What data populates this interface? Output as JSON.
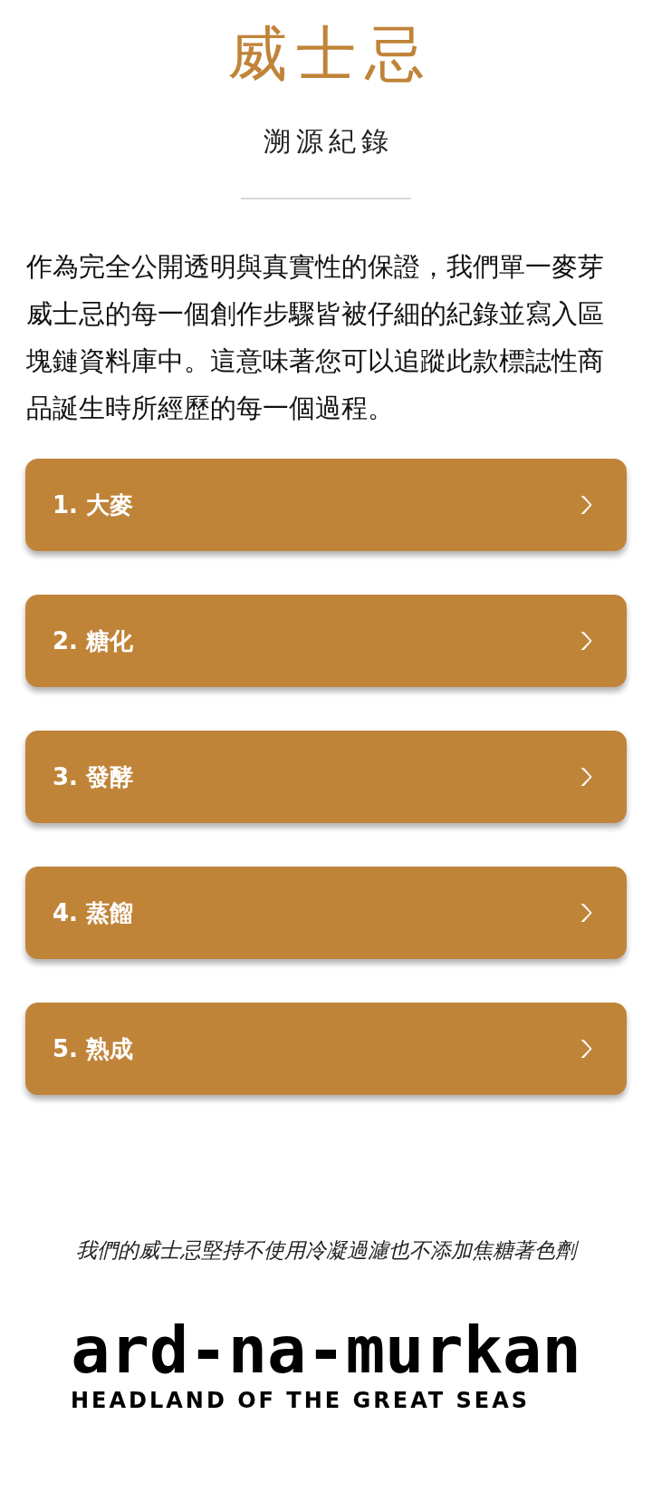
{
  "header": {
    "title": "威士忌",
    "subtitle": "溯源紀錄"
  },
  "intro": "作為完全公開透明與真實性的保證，我們單一麥芽威士忌的每一個創作步驟皆被仔細的紀錄並寫入區塊鏈資料庫中。這意味著您可以追蹤此款標誌性商品誕生時所經歷的每一個過程。",
  "steps": [
    {
      "label": "1. 大麥"
    },
    {
      "label": "2. 糖化"
    },
    {
      "label": "3. 發酵"
    },
    {
      "label": "4. 蒸餾"
    },
    {
      "label": "5. 熟成"
    }
  ],
  "footer": {
    "note": "我們的威士忌堅持不使用冷凝過濾也不添加焦糖著色劑",
    "brand": "ard-na-murkan",
    "tagline": "HEADLAND OF THE GREAT SEAS"
  }
}
